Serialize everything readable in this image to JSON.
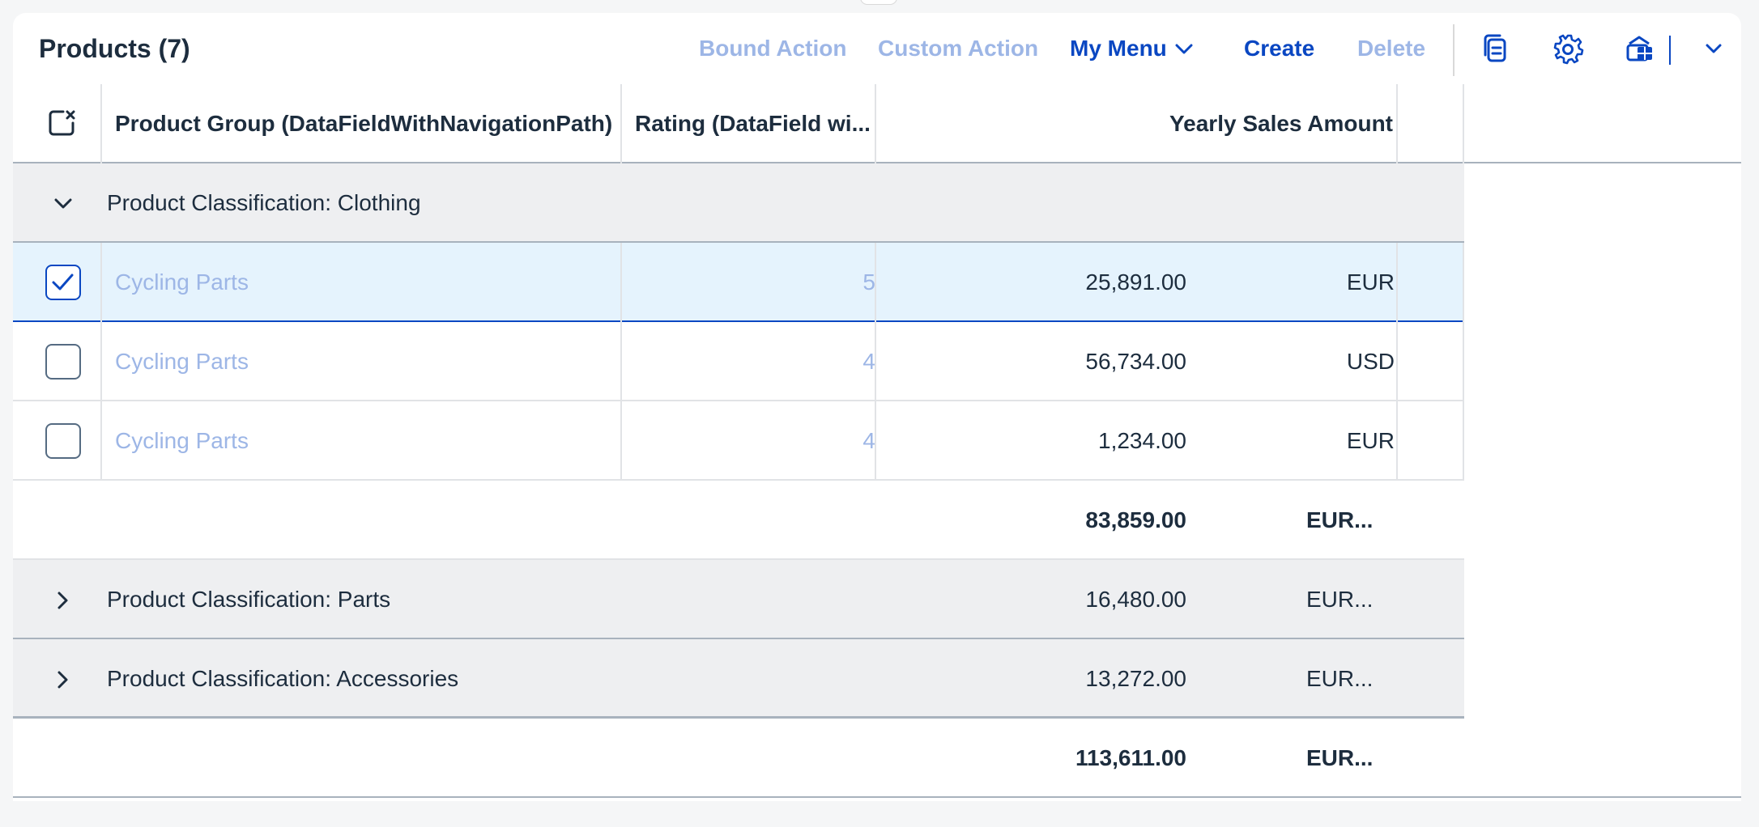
{
  "toolbar": {
    "title": "Products (7)",
    "bound_action": "Bound Action",
    "custom_action": "Custom Action",
    "my_menu": "My Menu",
    "create": "Create",
    "delete": "Delete"
  },
  "table": {
    "columns": {
      "product_group": "Product Group (DataFieldWithNavigationPath)",
      "rating": "Rating (DataField wi...",
      "yearly_sales": "Yearly Sales Amount"
    },
    "groups": [
      {
        "label": "Product Classification: Clothing",
        "expanded": true,
        "rows": [
          {
            "product": "Cycling Parts",
            "rating": "5",
            "amount": "25,891.00",
            "currency": "EUR",
            "selected": true
          },
          {
            "product": "Cycling Parts",
            "rating": "4",
            "amount": "56,734.00",
            "currency": "USD",
            "selected": false
          },
          {
            "product": "Cycling Parts",
            "rating": "4",
            "amount": "1,234.00",
            "currency": "EUR",
            "selected": false
          }
        ],
        "subtotal_amount": "83,859.00",
        "subtotal_currency": "EUR..."
      },
      {
        "label": "Product Classification: Parts",
        "expanded": false,
        "amount": "16,480.00",
        "currency": "EUR..."
      },
      {
        "label": "Product Classification: Accessories",
        "expanded": false,
        "amount": "13,272.00",
        "currency": "EUR..."
      }
    ],
    "grand_total_amount": "113,611.00",
    "grand_total_currency": "EUR..."
  },
  "icons": {
    "select_all": "clear-selection-icon",
    "copy": "copy-icon",
    "settings": "gear-icon",
    "export": "export-spreadsheet-icon",
    "export_menu": "chevron-down-icon"
  },
  "colors": {
    "link": "#9db6e6",
    "accent": "#0a47c2",
    "selected_row": "#e5f3fd",
    "group_row": "#eeeff1"
  }
}
